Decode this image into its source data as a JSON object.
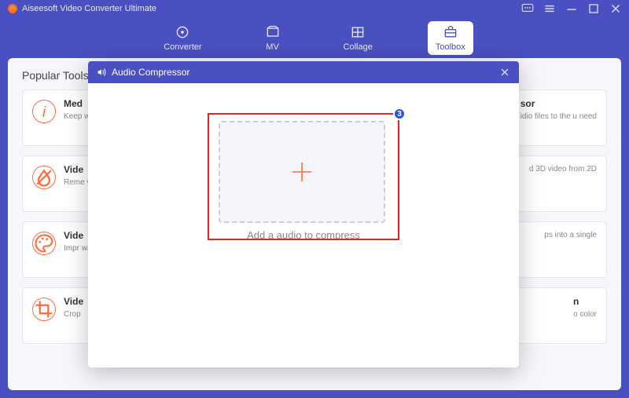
{
  "app": {
    "title": "Aiseesoft Video Converter Ultimate"
  },
  "tabs": [
    {
      "label": "Converter"
    },
    {
      "label": "MV"
    },
    {
      "label": "Collage"
    },
    {
      "label": "Toolbox"
    }
  ],
  "section": {
    "title": "Popular Tools"
  },
  "cards": [
    {
      "title": "Med",
      "desc": "Keep\nwant"
    },
    {
      "title": "",
      "desc": ""
    },
    {
      "title": "sor",
      "desc": "idio files to the\nu need"
    },
    {
      "title": "Vide",
      "desc": "Reme\nvidec"
    },
    {
      "title": "",
      "desc": ""
    },
    {
      "title": "",
      "desc": "d 3D video from 2D"
    },
    {
      "title": "Vide",
      "desc": "Impr\nways"
    },
    {
      "title": "",
      "desc": ""
    },
    {
      "title": "",
      "desc": "ps into a single"
    },
    {
      "title": "Vide",
      "desc": "Crop"
    },
    {
      "title": "",
      "desc": ""
    },
    {
      "title": "n",
      "desc": "o color"
    }
  ],
  "modal": {
    "title": "Audio Compressor",
    "drop_label": "Add a audio to compress",
    "badge": "3"
  }
}
